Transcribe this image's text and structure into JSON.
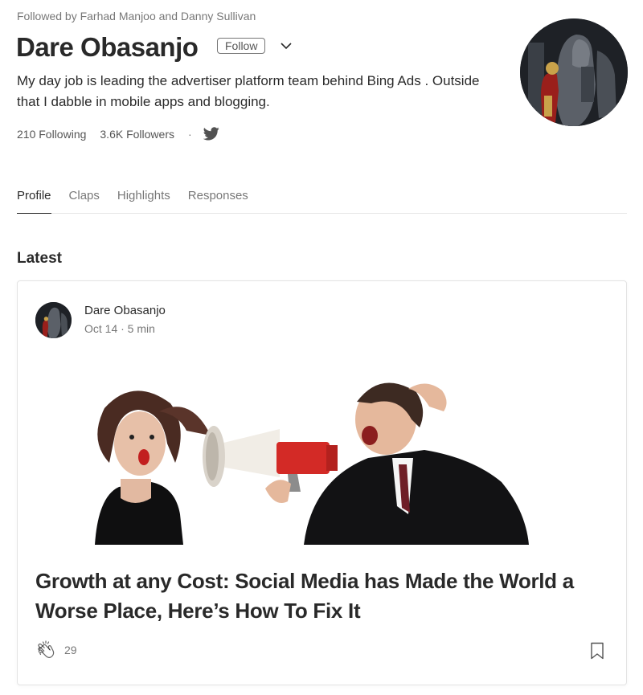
{
  "profile": {
    "followed_by": "Followed by Farhad Manjoo and Danny Sullivan",
    "name": "Dare Obasanjo",
    "follow_label": "Follow",
    "bio": "My day job is leading the advertiser platform team behind Bing Ads . Outside that I dabble in mobile apps and blogging.",
    "following": "210 Following",
    "followers": "3.6K Followers",
    "separator": "·",
    "twitter_icon": "twitter-icon",
    "avatar_icon": "avatar"
  },
  "tabs": [
    {
      "label": "Profile",
      "active": true
    },
    {
      "label": "Claps",
      "active": false
    },
    {
      "label": "Highlights",
      "active": false
    },
    {
      "label": "Responses",
      "active": false
    }
  ],
  "section": {
    "title": "Latest"
  },
  "post": {
    "author": "Dare Obasanjo",
    "meta": "Oct 14 · 5 min",
    "title": "Growth at any Cost: Social Media has Made the World a Worse Place, Here’s How To Fix It",
    "claps": "29",
    "clap_icon": "clap-icon",
    "bookmark_icon": "bookmark-icon"
  },
  "colors": {
    "megaphone_red": "#d32a26",
    "text_primary": "#292929",
    "text_secondary": "#757575"
  }
}
